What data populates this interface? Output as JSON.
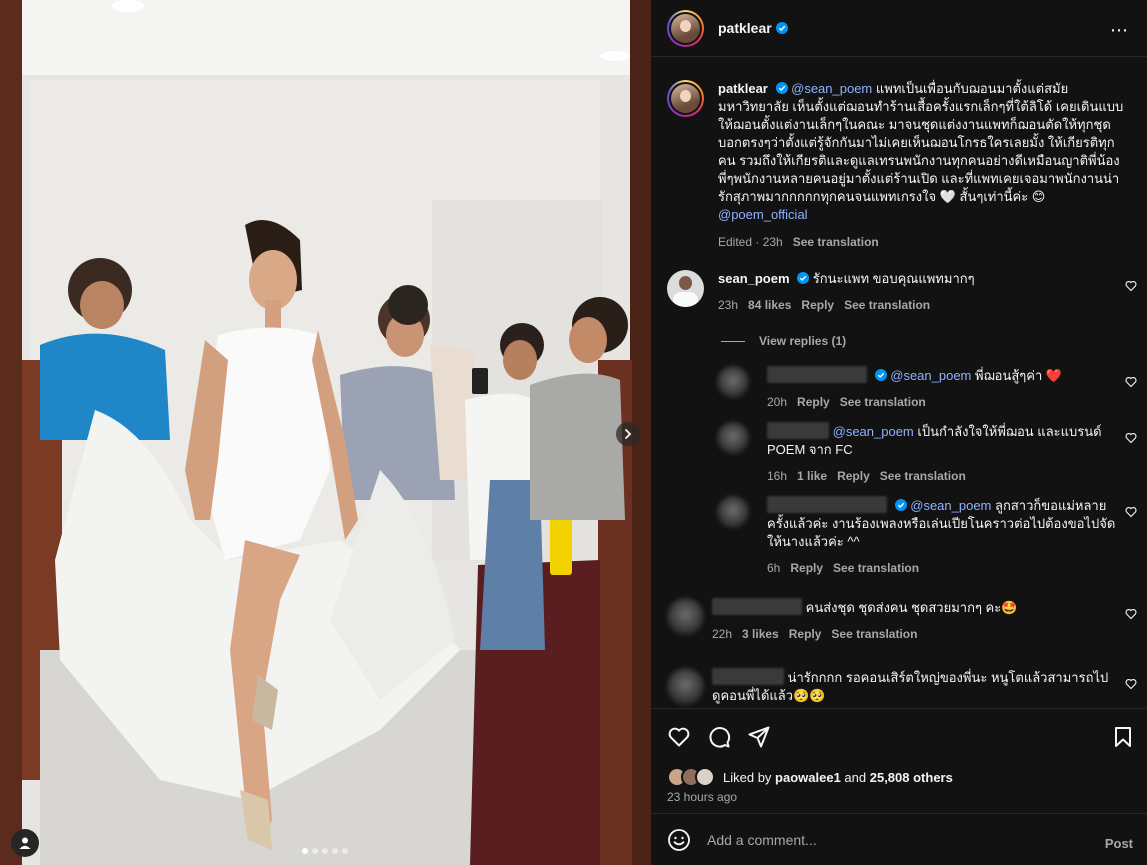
{
  "post": {
    "username": "patklear",
    "more_icon": "⋯",
    "caption_mention": "@sean_poem",
    "caption_text": " แพทเป็นเพื่อนกับฌอนมาตั้งแต่สมัยมหาวิทยาลัย เห็นตั้งแต่ฌอนทำร้านเสื้อครั้งแรกเล็กๆที่ใต้ลิโด้ เคยเดินแบบให้ฌอนตั้งแต่งานเล็กๆในคณะ มาจนชุดแต่งงานแพทก็ฌอนตัดให้ทุกชุด บอกตรงๆว่าตั้งแต่รู้จักกันมาไม่เคยเห็นฌอนโกรธใครเลยมั้ง ให้เกียรติทุกคน รวมถึงให้เกียรติและดูแลเทรนพนักงานทุกคนอย่างดีเหมือนญาติพี่น้อง พี่ๆพนักงานหลายคนอยู่มาตั้งแต่ร้านเปิด และที่แพทเคยเจอมาพนักงานน่ารักสุภาพมากกกกกทุกคนจนแพทเกรงใจ 🤍 สั้นๆเท่านี้ค่ะ 😊 ",
    "caption_mention2": "@poem_official",
    "caption_meta_edited": "Edited · 23h",
    "caption_meta_translate": "See translation",
    "likes_prefix": "Liked by ",
    "likes_user": "paowalee1",
    "likes_mid": " and ",
    "likes_count": "25,808 others",
    "time_ago": "23 hours ago",
    "add_comment_placeholder": "Add a comment...",
    "post_label": "Post"
  },
  "comments": [
    {
      "username": "sean_poem",
      "text": "รักนะแพท ขอบคุณแพทมากๆ",
      "time": "23h",
      "likes": "84 likes",
      "reply": "Reply",
      "translate": "See translation"
    }
  ],
  "view_replies": "View replies (1)",
  "replies": [
    {
      "mention": "@sean_poem",
      "text": " พี่ฌอนสู้ๆค่า ❤️",
      "time": "20h",
      "reply": "Reply",
      "translate": "See translation"
    },
    {
      "mention": "@sean_poem",
      "text": " เป็นกำลังใจให้พี่ฌอน และแบรนด์ POEM จาก FC",
      "time": "16h",
      "likes": "1 like",
      "reply": "Reply",
      "translate": "See translation"
    },
    {
      "mention": "@sean_poem",
      "text": " ลูกสาวก็ขอแม่หลายครั้งแล้วค่ะ งานร้องเพลงหรือเล่นเปียโนคราวต่อไปต้องขอไปจัดให้นางแล้วค่ะ ^^",
      "time": "6h",
      "reply": "Reply",
      "translate": "See translation"
    }
  ],
  "more_comments": [
    {
      "text": "คนส่งชุด ชุดส่งคน ชุดสวยมากๆ คะ🤩",
      "time": "22h",
      "likes": "3 likes",
      "reply": "Reply",
      "translate": "See translation"
    },
    {
      "text": "น่ารักกกก รอคอนเสิร์ตใหญ่ของพี่นะ หนูโตแล้วสามารถไปดูคอนพี่ได้แล้ว🥺🥺"
    }
  ],
  "icons": {
    "verified": "verified-badge-icon",
    "heart": "heart-icon",
    "comment": "comment-icon",
    "share": "share-icon",
    "save": "bookmark-icon",
    "emoji": "emoji-icon",
    "next": "chevron-right-icon",
    "tag": "user-tag-icon"
  },
  "colors": {
    "panel_bg": "#121212",
    "text": "#f5f5f5",
    "muted": "#a8a8a8",
    "link": "#e0f1ff",
    "verified_blue": "#0095f6",
    "like_red": "#ed4956"
  }
}
